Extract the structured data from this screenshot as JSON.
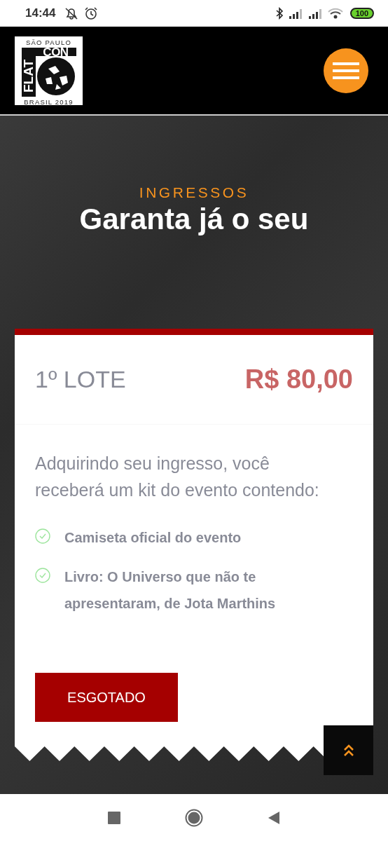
{
  "status_bar": {
    "time": "14:44",
    "battery": "100"
  },
  "header": {
    "logo": {
      "top": "SÃO PAULO",
      "vertical": "FLAT",
      "word": "CON",
      "bottom": "BRASIL 2019"
    }
  },
  "hero": {
    "eyebrow": "INGRESSOS",
    "title": "Garanta já o seu"
  },
  "ticket": {
    "sold_out": true,
    "lot": "1º LOTE",
    "price": "R$ 80,00",
    "description": "Adquirindo seu ingresso, você receberá um kit do evento contendo:",
    "items": [
      {
        "text": "Camiseta oficial do evento"
      },
      {
        "text": "Livro: O Universo que não te apresentaram, de Jota Marthins"
      }
    ],
    "button": "ESGOTADO"
  }
}
